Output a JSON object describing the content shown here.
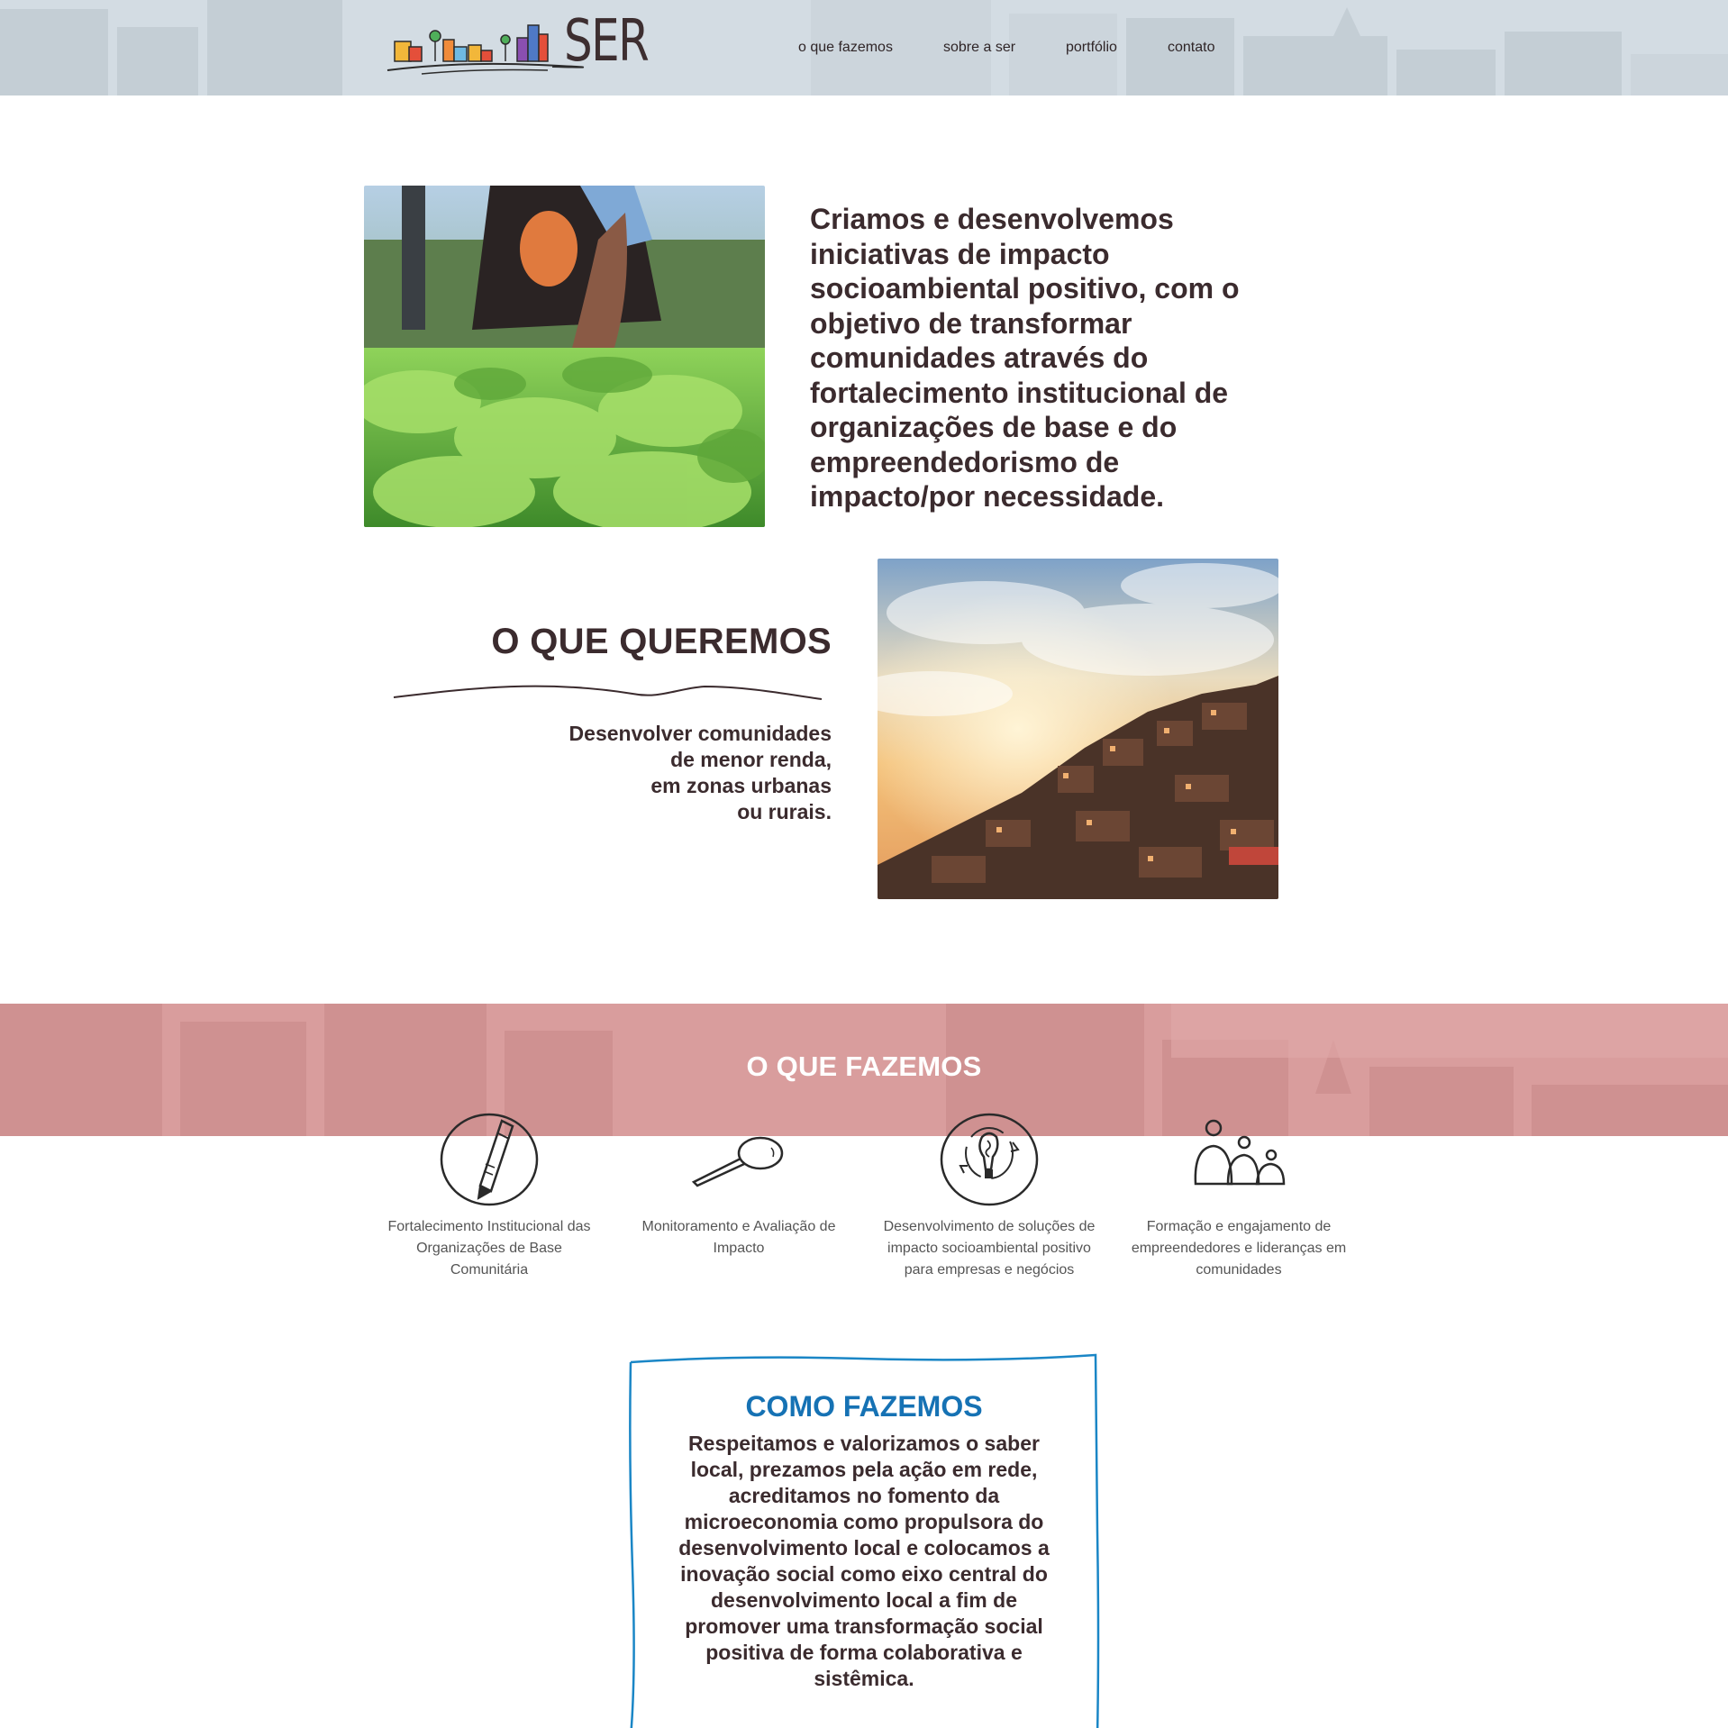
{
  "header": {
    "logo_text": "SER",
    "nav": [
      {
        "label": "o que fazemos"
      },
      {
        "label": "sobre a ser"
      },
      {
        "label": "portfólio"
      },
      {
        "label": "contato"
      }
    ]
  },
  "intro": {
    "text": "Criamos e desenvolvemos iniciativas de impacto socioambiental positivo, com o objetivo de transformar comunidades através do fortalecimento institucional de organizações de base e do empreendedorismo de impacto/por necessidade."
  },
  "queremos": {
    "title": "O QUE QUEREMOS",
    "lines": [
      "Desenvolver comunidades",
      "de menor renda,",
      "em zonas urbanas",
      "ou rurais."
    ]
  },
  "fazemos": {
    "title": "O QUE FAZEMOS",
    "items": [
      {
        "icon": "pencil-icon",
        "label": "Fortalecimento Institucional das Organizações de Base Comunitária"
      },
      {
        "icon": "magnifier-icon",
        "label": "Monitoramento e Avaliação de Impacto"
      },
      {
        "icon": "lightbulb-icon",
        "label": "Desenvolvimento de soluções de impacto socioambiental positivo para empresas e negócios"
      },
      {
        "icon": "people-icon",
        "label": "Formação e engajamento de empreendedores e lideranças em comunidades"
      }
    ]
  },
  "como": {
    "title": "COMO FAZEMOS",
    "text": "Respeitamos e valorizamos o saber local, prezamos pela ação em rede, acreditamos no fomento da microeconomia como propulsora do desenvolvimento local e colocamos a inovação social como eixo central do desenvolvimento local a fim de promover uma transformação social positiva de forma colaborativa e sistêmica."
  },
  "colors": {
    "header_bg": "#d3dce3",
    "band_bg": "#d99d9d",
    "text_dark": "#3b2b2e",
    "accent_blue": "#1672b4"
  }
}
